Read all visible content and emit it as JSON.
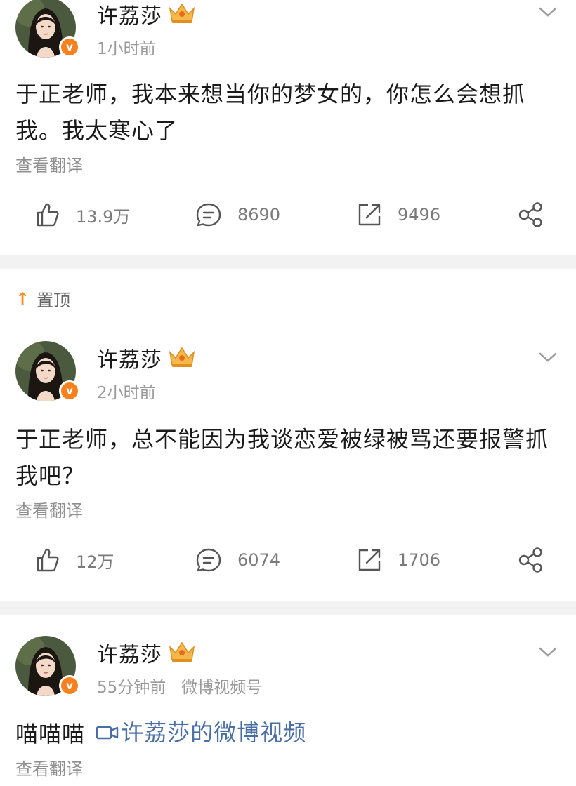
{
  "posts": [
    {
      "author": "许荔莎",
      "time": "1小时前",
      "source": "",
      "text": "于正老师，我本来想当你的梦女的，你怎么会想抓我。我太寒心了",
      "translate": "查看翻译",
      "likes": "13.9万",
      "comments": "8690",
      "reposts": "9496"
    },
    {
      "pinned_label": "置顶",
      "author": "许荔莎",
      "time": "2小时前",
      "source": "",
      "text": "于正老师，总不能因为我谈恋爱被绿被骂还要报警抓我吧？",
      "translate": "查看翻译",
      "likes": "12万",
      "comments": "6074",
      "reposts": "1706"
    },
    {
      "author": "许荔莎",
      "time": "55分钟前",
      "source": "微博视频号",
      "text": "喵喵喵",
      "video_link": "许荔莎的微博视频",
      "translate": "查看翻译"
    }
  ],
  "verified_badge": "v",
  "icons": [
    "like-icon",
    "comment-icon",
    "repost-icon",
    "share-icon",
    "chevron-down-icon",
    "crown-icon",
    "video-icon",
    "pin-arrow-icon"
  ],
  "colors": {
    "accent_orange": "#f5811f",
    "link_blue": "#4a6fa5",
    "divider": "#f2f2f2"
  }
}
